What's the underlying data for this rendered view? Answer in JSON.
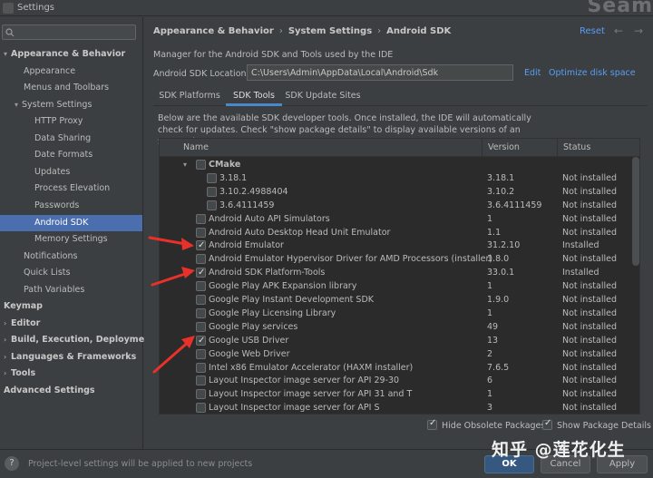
{
  "window": {
    "title": "Settings",
    "bg_text": "Seam"
  },
  "search": {
    "value": "",
    "placeholder": ""
  },
  "sidebar": {
    "items": [
      {
        "label": "Appearance & Behavior",
        "level": 0,
        "bold": true,
        "expanded": true
      },
      {
        "label": "Appearance",
        "level": 1
      },
      {
        "label": "Menus and Toolbars",
        "level": 1
      },
      {
        "label": "System Settings",
        "level": 1,
        "expanded": true
      },
      {
        "label": "HTTP Proxy",
        "level": 2
      },
      {
        "label": "Data Sharing",
        "level": 2
      },
      {
        "label": "Date Formats",
        "level": 2
      },
      {
        "label": "Updates",
        "level": 2
      },
      {
        "label": "Process Elevation",
        "level": 2
      },
      {
        "label": "Passwords",
        "level": 2
      },
      {
        "label": "Android SDK",
        "level": 2,
        "selected": true
      },
      {
        "label": "Memory Settings",
        "level": 2
      },
      {
        "label": "Notifications",
        "level": 1
      },
      {
        "label": "Quick Lists",
        "level": 1
      },
      {
        "label": "Path Variables",
        "level": 1
      },
      {
        "label": "Keymap",
        "level": 0,
        "bold": true
      },
      {
        "label": "Editor",
        "level": 0,
        "bold": true,
        "collapsed": true
      },
      {
        "label": "Build, Execution, Deployment",
        "level": 0,
        "bold": true,
        "collapsed": true
      },
      {
        "label": "Languages & Frameworks",
        "level": 0,
        "bold": true,
        "collapsed": true
      },
      {
        "label": "Tools",
        "level": 0,
        "bold": true,
        "collapsed": true
      },
      {
        "label": "Advanced Settings",
        "level": 0,
        "bold": true
      }
    ]
  },
  "breadcrumb": [
    "Appearance & Behavior",
    "System Settings",
    "Android SDK"
  ],
  "header": {
    "reset": "Reset",
    "back": "←",
    "forward": "→"
  },
  "main": {
    "description": "Manager for the Android SDK and Tools used by the IDE",
    "sdk_location_label": "Android SDK Location:",
    "sdk_location_value": "C:\\Users\\Admin\\AppData\\Local\\Android\\Sdk",
    "edit": "Edit",
    "optimize": "Optimize disk space",
    "tabs": [
      {
        "label": "SDK Platforms",
        "active": false
      },
      {
        "label": "SDK Tools",
        "active": true
      },
      {
        "label": "SDK Update Sites",
        "active": false
      }
    ],
    "info": "Below are the available SDK developer tools. Once installed, the IDE will automatically check for updates. Check \"show package details\" to display available versions of an SDK Tool."
  },
  "table": {
    "columns": [
      "Name",
      "Version",
      "Status"
    ],
    "rows": [
      {
        "name": "CMake",
        "version": "",
        "status": "",
        "indent": 1,
        "checked": false,
        "expander": true,
        "bold": true
      },
      {
        "name": "3.18.1",
        "version": "3.18.1",
        "status": "Not installed",
        "indent": 2,
        "checked": false
      },
      {
        "name": "3.10.2.4988404",
        "version": "3.10.2",
        "status": "Not installed",
        "indent": 2,
        "checked": false
      },
      {
        "name": "3.6.4111459",
        "version": "3.6.4111459",
        "status": "Not installed",
        "indent": 2,
        "checked": false
      },
      {
        "name": "Android Auto API Simulators",
        "version": "1",
        "status": "Not installed",
        "indent": 1,
        "checked": false
      },
      {
        "name": "Android Auto Desktop Head Unit Emulator",
        "version": "1.1",
        "status": "Not installed",
        "indent": 1,
        "checked": false
      },
      {
        "name": "Android Emulator",
        "version": "31.2.10",
        "status": "Installed",
        "indent": 1,
        "checked": true
      },
      {
        "name": "Android Emulator Hypervisor Driver for AMD Processors (installer)",
        "version": "1.8.0",
        "status": "Not installed",
        "indent": 1,
        "checked": false
      },
      {
        "name": "Android SDK Platform-Tools",
        "version": "33.0.1",
        "status": "Installed",
        "indent": 1,
        "checked": true
      },
      {
        "name": "Google Play APK Expansion library",
        "version": "1",
        "status": "Not installed",
        "indent": 1,
        "checked": false
      },
      {
        "name": "Google Play Instant Development SDK",
        "version": "1.9.0",
        "status": "Not installed",
        "indent": 1,
        "checked": false
      },
      {
        "name": "Google Play Licensing Library",
        "version": "1",
        "status": "Not installed",
        "indent": 1,
        "checked": false
      },
      {
        "name": "Google Play services",
        "version": "49",
        "status": "Not installed",
        "indent": 1,
        "checked": false
      },
      {
        "name": "Google USB Driver",
        "version": "13",
        "status": "Not installed",
        "indent": 1,
        "checked": true,
        "download": true
      },
      {
        "name": "Google Web Driver",
        "version": "2",
        "status": "Not installed",
        "indent": 1,
        "checked": false
      },
      {
        "name": "Intel x86 Emulator Accelerator (HAXM installer)",
        "version": "7.6.5",
        "status": "Not installed",
        "indent": 1,
        "checked": false
      },
      {
        "name": "Layout Inspector image server for API 29-30",
        "version": "6",
        "status": "Not installed",
        "indent": 1,
        "checked": false
      },
      {
        "name": "Layout Inspector image server for API 31 and T",
        "version": "1",
        "status": "Not installed",
        "indent": 1,
        "checked": false
      },
      {
        "name": "Layout Inspector image server for API S",
        "version": "3",
        "status": "Not installed",
        "indent": 1,
        "checked": false
      }
    ]
  },
  "options": {
    "hide_obsolete": "Hide Obsolete Packages",
    "show_details": "Show Package Details"
  },
  "footer": {
    "help": "?",
    "text": "Project-level settings will be applied to new projects",
    "ok": "OK",
    "cancel": "Cancel",
    "apply": "Apply"
  },
  "watermark": "知乎 @莲花化生",
  "colors": {
    "accent": "#4b6eaf",
    "link": "#589df6",
    "annotation": "#e8312a"
  }
}
